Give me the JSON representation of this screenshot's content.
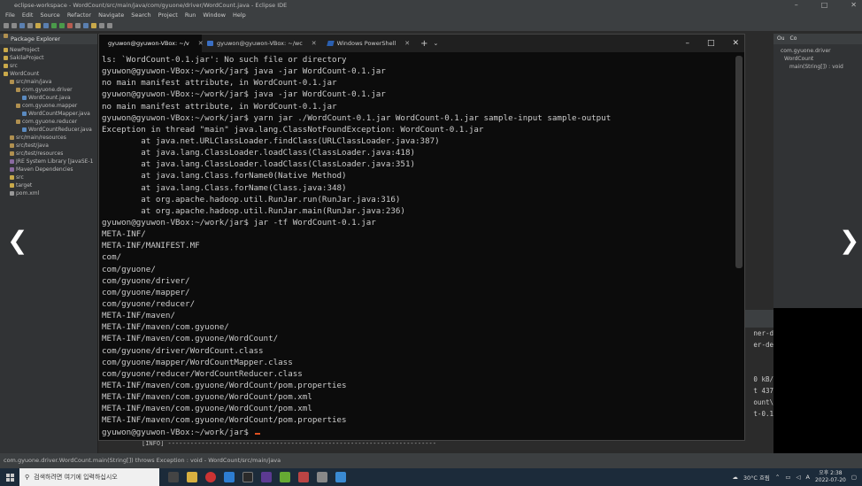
{
  "eclipse": {
    "title": "eclipse-workspace - WordCount/src/main/java/com/gyuone/driver/WordCount.java - Eclipse IDE",
    "menu": [
      "File",
      "Edit",
      "Source",
      "Refactor",
      "Navigate",
      "Search",
      "Project",
      "Run",
      "Window",
      "Help"
    ],
    "package_explorer_title": "Package Explorer",
    "tree": [
      {
        "label": "NewProject",
        "indent": 0,
        "icon": "folder"
      },
      {
        "label": "SakilaProject",
        "indent": 0,
        "icon": "folder"
      },
      {
        "label": "src",
        "indent": 0,
        "icon": "folder"
      },
      {
        "label": "WordCount",
        "indent": 0,
        "icon": "folder"
      },
      {
        "label": "src/main/java",
        "indent": 1,
        "icon": "pkg"
      },
      {
        "label": "com.gyuone.driver",
        "indent": 2,
        "icon": "pkg"
      },
      {
        "label": "WordCount.java",
        "indent": 3,
        "icon": "java"
      },
      {
        "label": "com.gyuone.mapper",
        "indent": 2,
        "icon": "pkg"
      },
      {
        "label": "WordCountMapper.java",
        "indent": 3,
        "icon": "java"
      },
      {
        "label": "com.gyuone.reducer",
        "indent": 2,
        "icon": "pkg"
      },
      {
        "label": "WordCountReducer.java",
        "indent": 3,
        "icon": "java"
      },
      {
        "label": "src/main/resources",
        "indent": 1,
        "icon": "pkg"
      },
      {
        "label": "src/test/java",
        "indent": 1,
        "icon": "pkg"
      },
      {
        "label": "src/test/resources",
        "indent": 1,
        "icon": "pkg"
      },
      {
        "label": "JRE System Library [JavaSE-1",
        "indent": 1,
        "icon": "lib"
      },
      {
        "label": "Maven Dependencies",
        "indent": 1,
        "icon": "lib"
      },
      {
        "label": "src",
        "indent": 1,
        "icon": "folder"
      },
      {
        "label": "target",
        "indent": 1,
        "icon": "folder"
      },
      {
        "label": "pom.xml",
        "indent": 1,
        "icon": "file"
      }
    ],
    "outline_tabs": [
      "Ou",
      "Co"
    ],
    "outline_items": [
      "com.gyuone.driver",
      "WordCount",
      "main(String[]) : void"
    ],
    "console_fragments": [
      "ner-d",
      "er-de",
      "",
      "",
      "0 kB/",
      "t 437",
      "ount\\",
      "t-0.1"
    ],
    "info_line": "[INFO] ------------------------------------------------------------------------",
    "status_text": "com.gyuone.driver.WordCount.main(String[]) throws Exception : void - WordCount/src/main/java"
  },
  "terminal": {
    "tabs": [
      {
        "label": "gyuwon@gyuwon-VBox: ~/v",
        "active": true
      },
      {
        "label": "gyuwon@gyuwon-VBox: ~/wc",
        "active": false
      },
      {
        "label": "Windows PowerShell",
        "active": false
      }
    ],
    "lines": [
      "ls: `WordCount-0.1.jar': No such file or directory",
      "gyuwon@gyuwon-VBox:~/work/jar$ java -jar WordCount-0.1.jar",
      "no main manifest attribute, in WordCount-0.1.jar",
      "gyuwon@gyuwon-VBox:~/work/jar$ java -jar WordCount-0.1.jar",
      "no main manifest attribute, in WordCount-0.1.jar",
      "gyuwon@gyuwon-VBox:~/work/jar$ yarn jar ./WordCount-0.1.jar WordCount-0.1.jar sample-input sample-output",
      "Exception in thread \"main\" java.lang.ClassNotFoundException: WordCount-0.1.jar",
      "        at java.net.URLClassLoader.findClass(URLClassLoader.java:387)",
      "        at java.lang.ClassLoader.loadClass(ClassLoader.java:418)",
      "        at java.lang.ClassLoader.loadClass(ClassLoader.java:351)",
      "        at java.lang.Class.forName0(Native Method)",
      "        at java.lang.Class.forName(Class.java:348)",
      "        at org.apache.hadoop.util.RunJar.run(RunJar.java:316)",
      "        at org.apache.hadoop.util.RunJar.main(RunJar.java:236)",
      "gyuwon@gyuwon-VBox:~/work/jar$ jar -tf WordCount-0.1.jar",
      "META-INF/",
      "META-INF/MANIFEST.MF",
      "com/",
      "com/gyuone/",
      "com/gyuone/driver/",
      "com/gyuone/mapper/",
      "com/gyuone/reducer/",
      "META-INF/maven/",
      "META-INF/maven/com.gyuone/",
      "META-INF/maven/com.gyuone/WordCount/",
      "com/gyuone/driver/WordCount.class",
      "com/gyuone/mapper/WordCountMapper.class",
      "com/gyuone/reducer/WordCountReducer.class",
      "META-INF/maven/com.gyuone/WordCount/pom.properties",
      "META-INF/maven/com.gyuone/WordCount/pom.xml",
      "META-INF/maven/com.gyuone/WordCount/pom.xml",
      "META-INF/maven/com.gyuone/WordCount/pom.properties"
    ],
    "final_prompt": "gyuwon@gyuwon-VBox:~/work/jar$ "
  },
  "nav": {
    "prev": "❮",
    "next": "❯"
  },
  "taskbar": {
    "search_placeholder": "검색하려면 여기에 입력하십시오",
    "weather": "30°C 흐림",
    "time": "오후 2:38",
    "date": "2022-07-20"
  }
}
